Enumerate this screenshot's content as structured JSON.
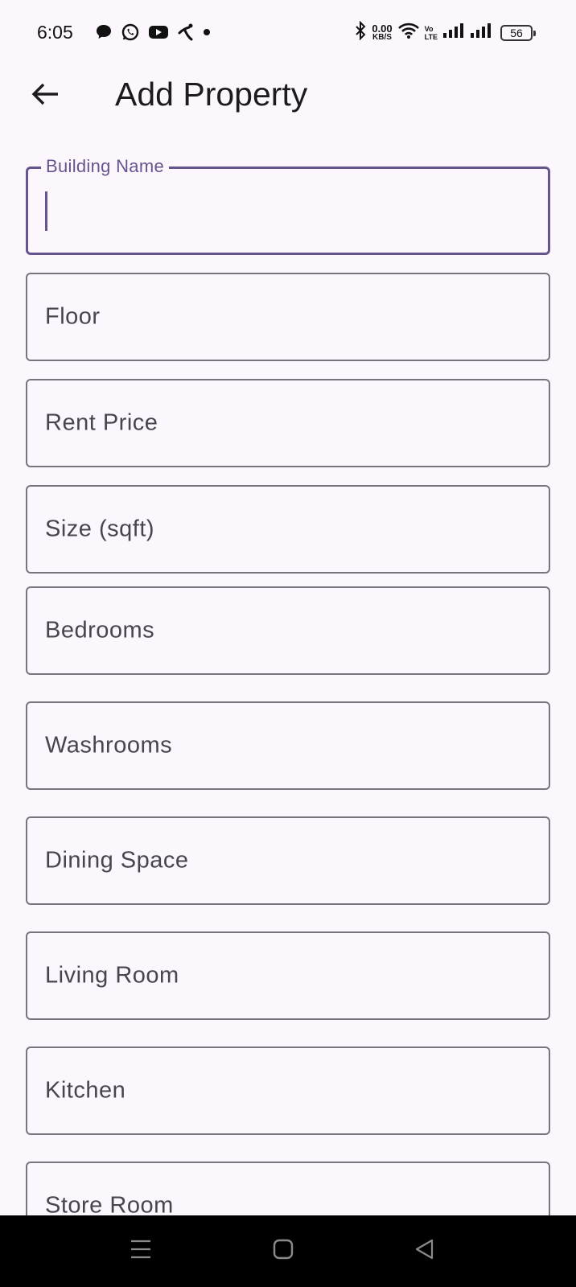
{
  "status_bar": {
    "time": "6:05",
    "net_speed_value": "0.00",
    "net_speed_unit": "KB/S",
    "volte_top": "Vo",
    "volte_bottom": "LTE",
    "battery_level": "56",
    "icons": [
      "chat-bubble-icon",
      "whatsapp-icon",
      "youtube-icon",
      "telenor-icon",
      "dot-icon",
      "bluetooth-icon",
      "wifi-icon",
      "signal-icon",
      "signal-icon-2"
    ]
  },
  "app_bar": {
    "title": "Add Property",
    "back_icon": "arrow-left-icon"
  },
  "form": {
    "focused_field": "Building Name",
    "fields": [
      {
        "label": "Building Name"
      },
      {
        "label": "Floor"
      },
      {
        "label": "Rent Price"
      },
      {
        "label": "Size (sqft)"
      },
      {
        "label": "Bedrooms"
      },
      {
        "label": "Washrooms"
      },
      {
        "label": "Dining Space"
      },
      {
        "label": "Living Room"
      },
      {
        "label": "Kitchen"
      },
      {
        "label": "Store Room"
      }
    ]
  },
  "colors": {
    "background": "#fcf7fc",
    "accent": "#65558f",
    "outline": "#79747e",
    "label": "#49454f"
  },
  "nav_bar": {
    "icons": [
      "menu-icon",
      "home-square-icon",
      "back-triangle-icon"
    ]
  }
}
